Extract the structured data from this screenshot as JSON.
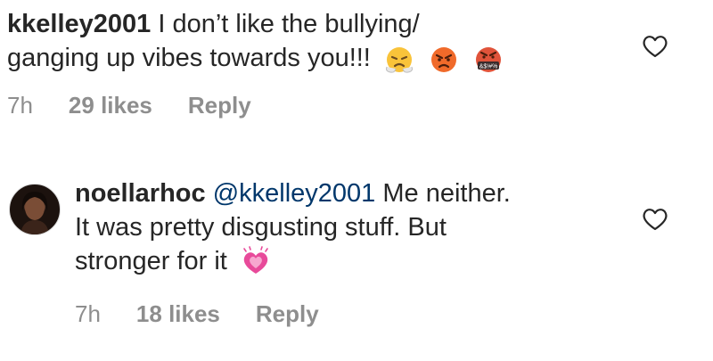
{
  "comments": [
    {
      "username": "kkelley2001",
      "text_line1": " I don’t like the bullying/",
      "text_line2": "ganging up vibes towards you!!!",
      "emojis": [
        "face-with-steam-icon",
        "angry-face-icon",
        "cursing-face-icon"
      ],
      "cursing_symbols": "&$!#%",
      "time": "7h",
      "likes": "29 likes",
      "reply_label": "Reply"
    },
    {
      "username": "noellarhoc",
      "mention": "@kkelley2001",
      "text_line1": " Me neither.",
      "text_line2": "It was pretty disgusting stuff. But",
      "text_line3": "stronger for it",
      "emojis": [
        "growing-heart-icon"
      ],
      "time": "7h",
      "likes": "18 likes",
      "reply_label": "Reply"
    }
  ],
  "colors": {
    "text": "#262626",
    "meta": "#8e8e8e",
    "mention": "#00376b",
    "heart_emoji": "#e84a9a"
  }
}
